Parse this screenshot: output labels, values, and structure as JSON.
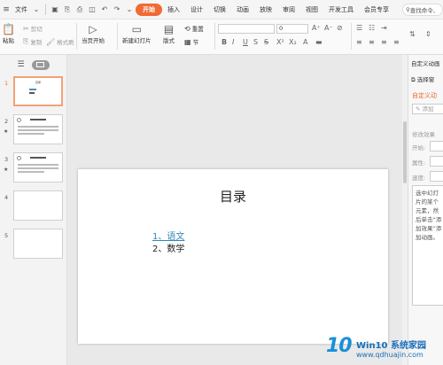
{
  "menubar": {
    "file_label": "文件",
    "tabs": [
      "开始",
      "插入",
      "设计",
      "切换",
      "动画",
      "放映",
      "审阅",
      "视图",
      "开发工具",
      "会员专享"
    ],
    "search_placeholder": "查找命令、"
  },
  "ribbon": {
    "paste": "粘贴",
    "cut": "剪切",
    "copy": "复制",
    "format_painter": "格式刷",
    "from_current": "当页开始",
    "new_slide": "新建幻灯片",
    "layout": "版式",
    "section": "节",
    "reset": "重置",
    "font_size": "0"
  },
  "slides_panel": {
    "slides": [
      {
        "number": "1",
        "title": "目录",
        "star": ""
      },
      {
        "number": "2",
        "title": "",
        "star": "★"
      },
      {
        "number": "3",
        "title": "",
        "star": "★"
      },
      {
        "number": "4",
        "title": "",
        "star": ""
      },
      {
        "number": "5",
        "title": "",
        "star": ""
      }
    ]
  },
  "slide": {
    "title": "目录",
    "items": [
      "1、语文",
      "2、数学"
    ]
  },
  "right_panel": {
    "title": "自定义动画",
    "select_pane": "选择窗",
    "custom_heading": "自定义动",
    "add_effect": "添加",
    "modify_label": "修改效果",
    "start_label": "开始:",
    "property_label": "属性:",
    "speed_label": "速度:",
    "hint_text": "选中幻灯片的某个元素，然后单击“添加效果”添加动画。"
  },
  "watermark": {
    "logo": "10",
    "brand": "Win10 系统家园",
    "url": "www.qdhuajin.com"
  }
}
